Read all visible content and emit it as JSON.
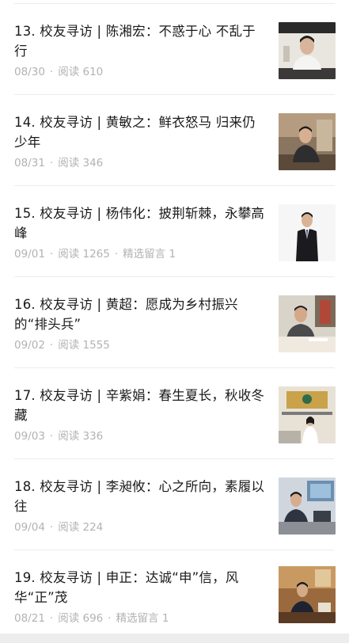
{
  "articles": [
    {
      "title": "13. 校友寻访 | 陈湘宏：不惑于心 不乱于行",
      "date": "08/30",
      "reads": "阅读 610",
      "extra": ""
    },
    {
      "title": "14. 校友寻访 | 黄敏之：鲜衣怒马 归来仍少年",
      "date": "08/31",
      "reads": "阅读 346",
      "extra": ""
    },
    {
      "title": "15. 校友寻访 | 杨伟化：披荆斩棘，永攀高峰",
      "date": "09/01",
      "reads": "阅读 1265",
      "extra": "精选留言 1"
    },
    {
      "title": "16. 校友寻访 | 黄超：愿成为乡村振兴的“排头兵”",
      "date": "09/02",
      "reads": "阅读 1555",
      "extra": ""
    },
    {
      "title": "17. 校友寻访 | 辛紫娟：春生夏长，秋收冬藏",
      "date": "09/03",
      "reads": "阅读 336",
      "extra": ""
    },
    {
      "title": "18. 校友寻访 | 李昶攸：心之所向，素履以往",
      "date": "09/04",
      "reads": "阅读 224",
      "extra": ""
    },
    {
      "title": "19. 校友寻访 | 申正：达诚“申”信，风华“正”茂",
      "date": "08/21",
      "reads": "阅读 696",
      "extra": "精选留言 1"
    }
  ]
}
